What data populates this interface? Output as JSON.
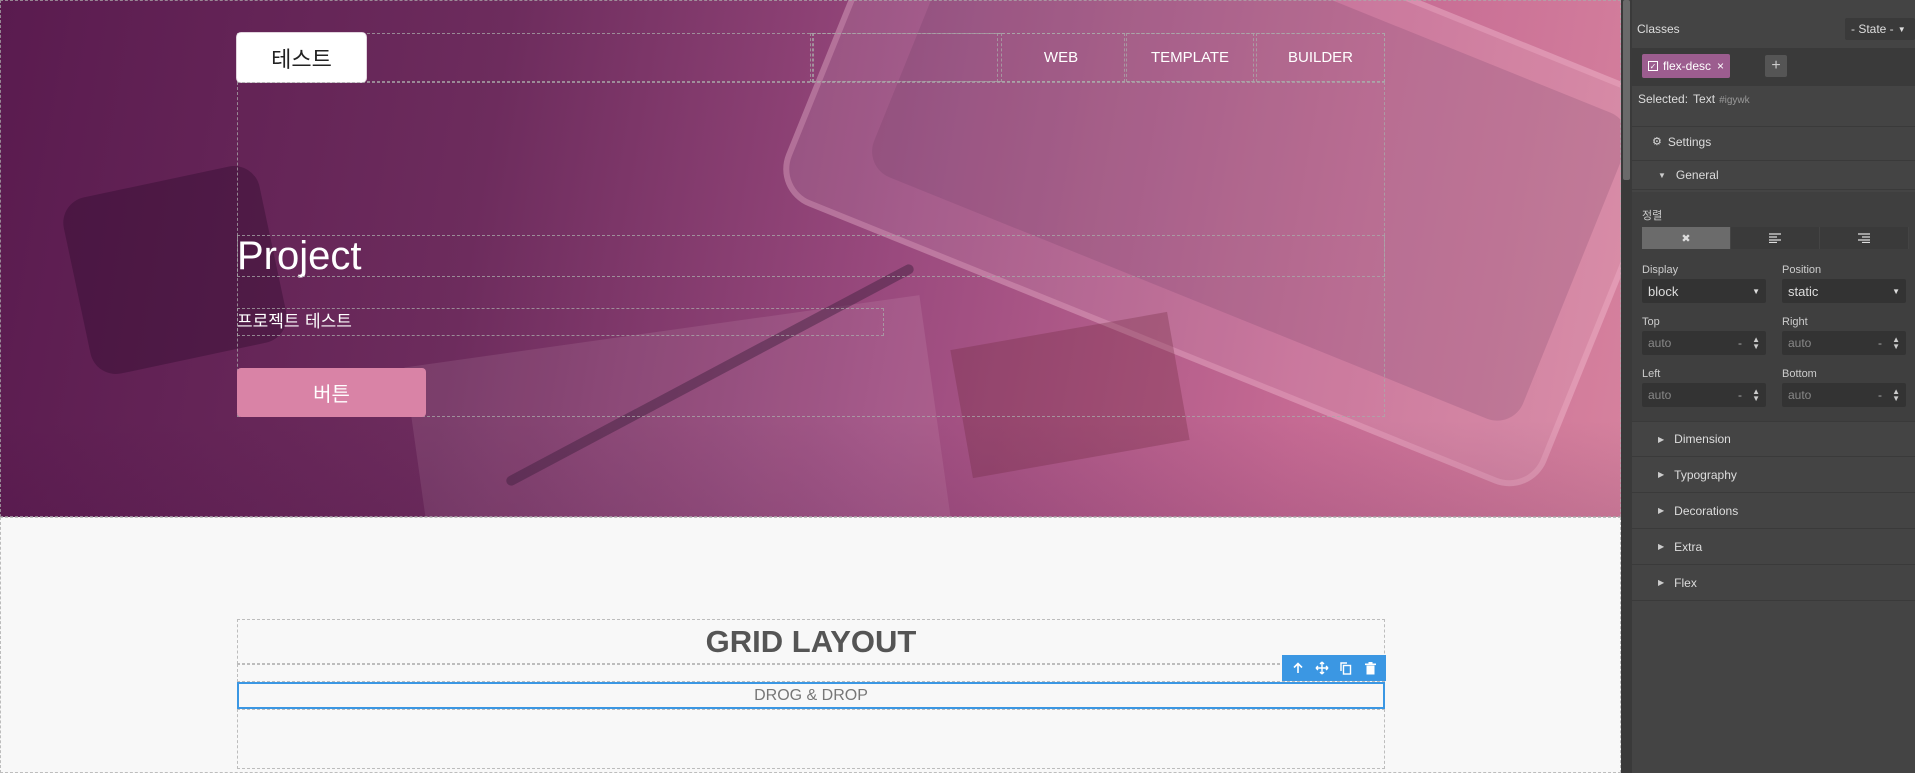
{
  "colors": {
    "accent": "#3b97e3",
    "button": "#d983a6",
    "tag": "#9c5d8f",
    "panel_bg": "#444444"
  },
  "canvas": {
    "brand": "테스트",
    "nav_links": [
      "WEB",
      "TEMPLATE",
      "BUILDER"
    ],
    "hero_title": "Project",
    "hero_subtitle": "프로젝트 테스트",
    "hero_button": "버튼",
    "grid_title": "GRID LAYOUT",
    "grid_subtitle": "DROG & DROP"
  },
  "toolbar": {
    "icons": [
      "arrow-up-icon",
      "move-icon",
      "copy-icon",
      "delete-icon"
    ]
  },
  "panel": {
    "classes_label": "Classes",
    "state_select": "- State -",
    "tag": "flex-desc",
    "selected_label": "Selected:",
    "selected_value": "Text",
    "selected_id": "#igywk",
    "settings_label": "Settings",
    "general_label": "General",
    "align_label": "정렬",
    "display_label": "Display",
    "display_value": "block",
    "position_label": "Position",
    "position_value": "static",
    "top_label": "Top",
    "right_label": "Right",
    "left_label": "Left",
    "bottom_label": "Bottom",
    "auto": "auto",
    "unit": "-",
    "sections": [
      "Dimension",
      "Typography",
      "Decorations",
      "Extra",
      "Flex"
    ]
  }
}
